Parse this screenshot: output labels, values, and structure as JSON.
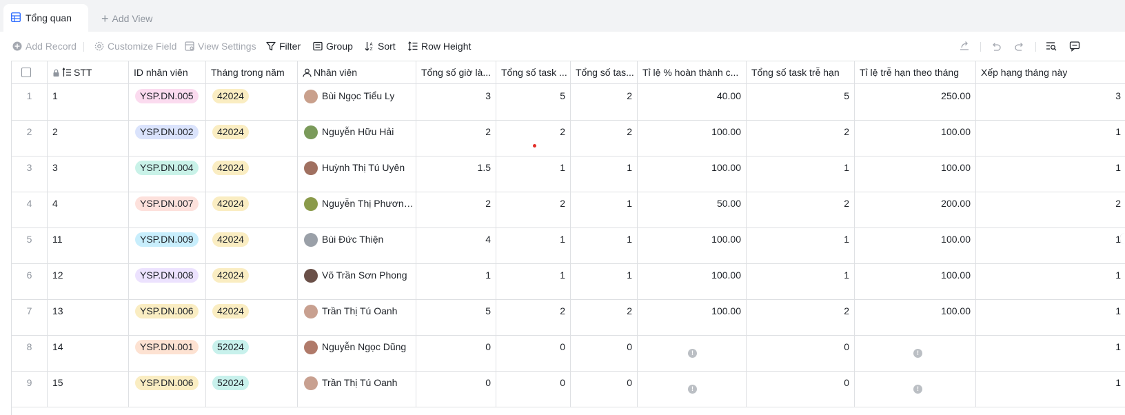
{
  "tabs": {
    "active_label": "Tổng quan",
    "add_view_label": "Add View"
  },
  "toolbar": {
    "add_record": "Add Record",
    "customize_field": "Customize Field",
    "view_settings": "View Settings",
    "filter": "Filter",
    "group": "Group",
    "sort": "Sort",
    "row_height": "Row Height"
  },
  "columns": {
    "stt": "STT",
    "id": "ID nhân viên",
    "month": "Tháng trong năm",
    "employee": "Nhân viên",
    "hours": "Tổng số giờ là...",
    "tasks": "Tổng số task ...",
    "tasks_done": "Tổng số tas...",
    "pct_done": "Tỉ lệ % hoàn thành c...",
    "late_tasks": "Tổng số task trễ hạn",
    "late_rate": "Tỉ lệ trễ hạn theo tháng",
    "rank": "Xếp hạng tháng này"
  },
  "rows": [
    {
      "index": "1",
      "stt": "1",
      "id": "YSP.DN.005",
      "month": "42024",
      "employee": "Bùi Ngọc Tiểu Ly",
      "hours": "3",
      "tasks": "5",
      "tasks_done": "2",
      "pct_done": "40.00",
      "late_tasks": "5",
      "late_rate": "250.00",
      "rank": "3"
    },
    {
      "index": "2",
      "stt": "2",
      "id": "YSP.DN.002",
      "month": "42024",
      "employee": "Nguyễn Hữu Hải",
      "hours": "2",
      "tasks": "2",
      "tasks_done": "2",
      "pct_done": "100.00",
      "late_tasks": "2",
      "late_rate": "100.00",
      "rank": "1"
    },
    {
      "index": "3",
      "stt": "3",
      "id": "YSP.DN.004",
      "month": "42024",
      "employee": "Huỳnh Thị Tú Uyên",
      "hours": "1.5",
      "tasks": "1",
      "tasks_done": "1",
      "pct_done": "100.00",
      "late_tasks": "1",
      "late_rate": "100.00",
      "rank": "1"
    },
    {
      "index": "4",
      "stt": "4",
      "id": "YSP.DN.007",
      "month": "42024",
      "employee": "Nguyễn Thị Phương ...",
      "hours": "2",
      "tasks": "2",
      "tasks_done": "1",
      "pct_done": "50.00",
      "late_tasks": "2",
      "late_rate": "200.00",
      "rank": "2"
    },
    {
      "index": "5",
      "stt": "11",
      "id": "YSP.DN.009",
      "month": "42024",
      "employee": "Bùi Đức Thiện",
      "hours": "4",
      "tasks": "1",
      "tasks_done": "1",
      "pct_done": "100.00",
      "late_tasks": "1",
      "late_rate": "100.00",
      "rank": "1"
    },
    {
      "index": "6",
      "stt": "12",
      "id": "YSP.DN.008",
      "month": "42024",
      "employee": "Võ Trần Sơn Phong",
      "hours": "1",
      "tasks": "1",
      "tasks_done": "1",
      "pct_done": "100.00",
      "late_tasks": "1",
      "late_rate": "100.00",
      "rank": "1"
    },
    {
      "index": "7",
      "stt": "13",
      "id": "YSP.DN.006",
      "month": "42024",
      "employee": "Trần Thị Tú Oanh",
      "hours": "5",
      "tasks": "2",
      "tasks_done": "2",
      "pct_done": "100.00",
      "late_tasks": "2",
      "late_rate": "100.00",
      "rank": "1"
    },
    {
      "index": "8",
      "stt": "14",
      "id": "YSP.DN.001",
      "month": "52024",
      "employee": "Nguyễn Ngọc Dũng",
      "hours": "0",
      "tasks": "0",
      "tasks_done": "0",
      "pct_done": "",
      "late_tasks": "0",
      "late_rate": "",
      "rank": "1"
    },
    {
      "index": "9",
      "stt": "15",
      "id": "YSP.DN.006",
      "month": "52024",
      "employee": "Trần Thị Tú Oanh",
      "hours": "0",
      "tasks": "0",
      "tasks_done": "0",
      "pct_done": "",
      "late_tasks": "0",
      "late_rate": "",
      "rank": "1"
    }
  ],
  "tag_colors": {
    "YSP.DN.005": "#fbdbef",
    "YSP.DN.002": "#dae3fc",
    "YSP.DN.004": "#c9f2e8",
    "YSP.DN.007": "#fde1dc",
    "YSP.DN.009": "#c8eefc",
    "YSP.DN.008": "#ece2fe",
    "YSP.DN.006": "#faedc2",
    "YSP.DN.001": "#fde2d2",
    "42024": "#faedc2",
    "52024": "#c8f1ec"
  },
  "avatar_colors": [
    "#c9a08c",
    "#7a9a5a",
    "#a07060",
    "#8a9a4a",
    "#9aa0a8",
    "#6a5048",
    "#c8a090",
    "#b07a6a",
    "#c8a090"
  ]
}
